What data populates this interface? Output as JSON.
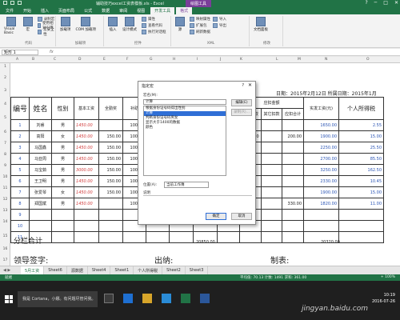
{
  "titlebar": {
    "title": "辅助技巧excel工资表模板.xls - Excel",
    "tool_tab": "绘图工具",
    "win_buttons": [
      "?",
      "─",
      "□",
      "✕"
    ]
  },
  "ribbon": {
    "tabs": [
      "文件",
      "开始",
      "插入",
      "页面布局",
      "公式",
      "数据",
      "审阅",
      "视图",
      "开发工具",
      "格式"
    ],
    "active_tab": "开发工具",
    "groups": [
      {
        "name": "代码",
        "items": [
          "Visual Basic",
          "宏",
          "录制宏",
          "使用相对引用",
          "宏安全性"
        ]
      },
      {
        "name": "加载项",
        "items": [
          "加载项",
          "COM 加载项"
        ]
      },
      {
        "name": "控件",
        "items": [
          "插入",
          "设计模式",
          "属性",
          "查看代码",
          "执行对话框"
        ]
      },
      {
        "name": "XML",
        "items": [
          "源",
          "映射属性",
          "扩展包",
          "刷新数据",
          "导入",
          "导出"
        ]
      },
      {
        "name": "修改",
        "items": [
          "文档面板"
        ]
      }
    ]
  },
  "formula_bar": {
    "name_box": "矩形 1",
    "fx": "fx",
    "value": ""
  },
  "columns": [
    "A",
    "B",
    "C",
    "D",
    "E",
    "F",
    "G",
    "H",
    "I",
    "J",
    "K",
    "L",
    "M",
    "N",
    "O"
  ],
  "rows": [
    "1",
    "2",
    "3",
    "4",
    "5",
    "6",
    "7",
    "8",
    "9",
    "10",
    "11",
    "12",
    "13",
    "14",
    "15",
    "16",
    "17"
  ],
  "sheet": {
    "head_info": "日期：2015年2月12日 所属日期：2015年1月",
    "headers": {
      "no": "编号",
      "name": "姓名",
      "sex": "性别",
      "base": "基本工资",
      "full": "全勤奖",
      "subsidy": "补助",
      "should": "应发",
      "deduct_group": "应扣金额",
      "deduct_a": "受贿扣款",
      "deduct_b": "其它扣款",
      "deduct_total": "应扣合计",
      "actual": "实发工资(元)",
      "tax": "个人所得税"
    },
    "employees": [
      {
        "no": "1",
        "name": "刘睿",
        "sex": "男",
        "base": "1450.00",
        "full": "",
        "subsidy": "100.00",
        "deduct_a": "",
        "deduct_b": "",
        "deduct_total": "",
        "actual": "1650.00",
        "tax": "2.55"
      },
      {
        "no": "2",
        "name": "高阳",
        "sex": "女",
        "base": "1450.00",
        "full": "150.00",
        "subsidy": "100.00",
        "deduct_a": "200.00",
        "deduct_b": "",
        "deduct_total": "200.00",
        "actual": "1900.00",
        "tax": "15.00"
      },
      {
        "no": "3",
        "name": "马国鑫",
        "sex": "男",
        "base": "1450.00",
        "full": "150.00",
        "subsidy": "100.00",
        "deduct_a": "",
        "deduct_b": "",
        "deduct_total": "",
        "actual": "2250.00",
        "tax": "25.50"
      },
      {
        "no": "4",
        "name": "马亚周",
        "sex": "男",
        "base": "1450.00",
        "full": "150.00",
        "subsidy": "100.00",
        "deduct_a": "",
        "deduct_b": "",
        "deduct_total": "",
        "actual": "2700.00",
        "tax": "85.50"
      },
      {
        "no": "5",
        "name": "马宝茹",
        "sex": "男",
        "base": "3000.00",
        "full": "150.00",
        "subsidy": "100.00",
        "deduct_a": "",
        "deduct_b": "",
        "deduct_total": "",
        "actual": "3250.00",
        "tax": "162.50"
      },
      {
        "no": "6",
        "name": "王卫明",
        "sex": "男",
        "base": "1450.00",
        "full": "150.00",
        "subsidy": "100.00",
        "deduct_a": "",
        "deduct_b": "",
        "deduct_total": "",
        "actual": "2330.00",
        "tax": "10.45"
      },
      {
        "no": "7",
        "name": "张爱琴",
        "sex": "女",
        "base": "1450.00",
        "full": "150.00",
        "subsidy": "100.00",
        "deduct_a": "",
        "deduct_b": "",
        "deduct_total": "",
        "actual": "1900.00",
        "tax": "15.00"
      },
      {
        "no": "8",
        "name": "郑国斌",
        "sex": "男",
        "base": "1450.00",
        "full": "",
        "subsidy": "100.00",
        "deduct_a": "",
        "deduct_b": "",
        "deduct_total": "330.00",
        "actual": "1820.00",
        "tax": "11.00"
      },
      {
        "no": "9",
        "name": "",
        "sex": "",
        "base": "",
        "full": "",
        "subsidy": "",
        "deduct_a": "",
        "deduct_b": "",
        "deduct_total": "",
        "actual": "",
        "tax": ""
      },
      {
        "no": "10",
        "name": "",
        "sex": "",
        "base": "",
        "full": "",
        "subsidy": "",
        "deduct_a": "",
        "deduct_b": "",
        "deduct_total": "",
        "actual": "",
        "tax": ""
      },
      {
        "no": "11",
        "name": "",
        "sex": "",
        "base": "",
        "full": "",
        "subsidy": "",
        "deduct_a": "",
        "deduct_b": "",
        "deduct_total": "",
        "actual": "",
        "tax": ""
      }
    ],
    "subtotal_label": "分栏合计",
    "subtotal_should": "20850.00",
    "subtotal_actual": "20320.00",
    "sign_leader": "领导签字:",
    "sign_cashier": "出纳:",
    "sign_maker": "制表:"
  },
  "dialog": {
    "title": "指定宏",
    "help": "?",
    "close": "✕",
    "macro_name_label": "宏名(M):",
    "macro_name_value": "计算",
    "macros": [
      "根据身份证号码得出性别",
      "计算",
      "判断身份证号码男女",
      "显示大于1400的数据",
      "颜色"
    ],
    "selected_macro": "计算",
    "edit_button": "编辑(E)",
    "record_button": "录制(R)...",
    "scope_label": "位置(A):",
    "scope_value": "当前工作簿",
    "desc_label": "说明",
    "ok_button": "确定",
    "cancel_button": "取消"
  },
  "sheet_tabs": [
    "5月工资",
    "Sheet6",
    "源数据",
    "Sheet4",
    "Sheet1",
    "个人所得税",
    "Sheet2",
    "Sheet3"
  ],
  "active_sheet": "5月工资",
  "statusbar": {
    "mode": "就绪",
    "stats": "平均值: 70.13   计数: 1491   求和: 361.00",
    "zoom": "+ 100%"
  },
  "taskbar": {
    "search_placeholder": "我是 Cortana，小娜。有问题尽管问我。",
    "time": "10:19",
    "date": "2016-07-26",
    "watermark": "jingyan.baidu.com"
  },
  "colors": {
    "excel_green": "#217346",
    "tool_purple": "#7a3e99",
    "selection_blue": "#2f6fd6",
    "red_text": "#d13b3b",
    "blue_text": "#2a54b4"
  }
}
